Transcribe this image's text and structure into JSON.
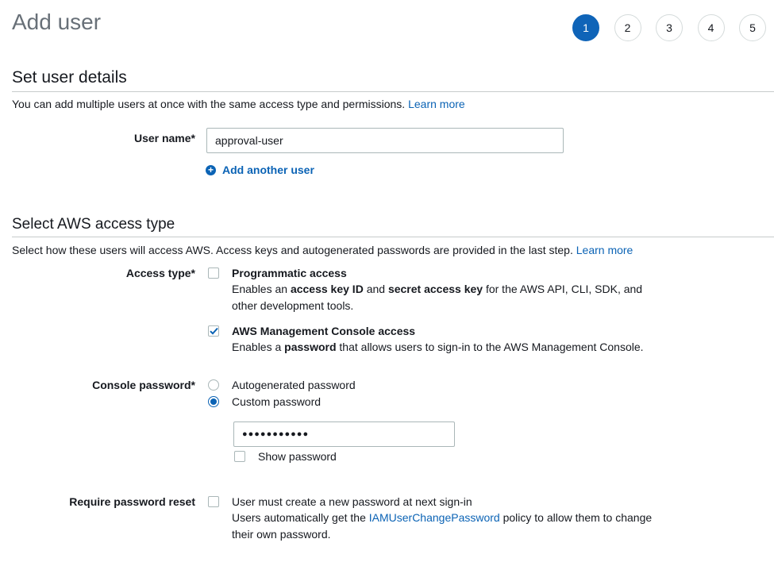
{
  "header": {
    "title": "Add user",
    "steps": [
      "1",
      "2",
      "3",
      "4",
      "5"
    ],
    "active_step": "1"
  },
  "details": {
    "section_title": "Set user details",
    "description": "You can add multiple users at once with the same access type and permissions.",
    "learn_more": "Learn more",
    "user_name_label": "User name*",
    "user_name_value": "approval-user",
    "add_another_user": "Add another user"
  },
  "access": {
    "section_title": "Select AWS access type",
    "description": "Select how these users will access AWS. Access keys and autogenerated passwords are provided in the last step.",
    "learn_more": "Learn more",
    "access_type_label": "Access type*",
    "programmatic": {
      "title": "Programmatic access",
      "checked": false,
      "desc_1": "Enables an ",
      "desc_bold_1": "access key ID",
      "desc_2": " and ",
      "desc_bold_2": "secret access key",
      "desc_3": " for the AWS API, CLI, SDK, and other development tools."
    },
    "console": {
      "title": "AWS Management Console access",
      "checked": true,
      "desc_1": "Enables a ",
      "desc_bold_1": "password",
      "desc_2": " that allows users to sign-in to the AWS Management Console."
    }
  },
  "password": {
    "label": "Console password*",
    "autogenerated": "Autogenerated password",
    "custom": "Custom password",
    "selected": "custom",
    "masked_value": "●●●●●●●●●●●",
    "show_password": "Show password",
    "show_password_checked": false
  },
  "reset": {
    "label": "Require password reset",
    "checked": false,
    "title": "User must create a new password at next sign-in",
    "desc_1": "Users automatically get the ",
    "policy_link": "IAMUserChangePassword",
    "desc_2": " policy to allow them to change their own password."
  },
  "colors": {
    "accent": "#0b63b5",
    "active_step": "#0f64b8",
    "title_gray": "#687078"
  }
}
